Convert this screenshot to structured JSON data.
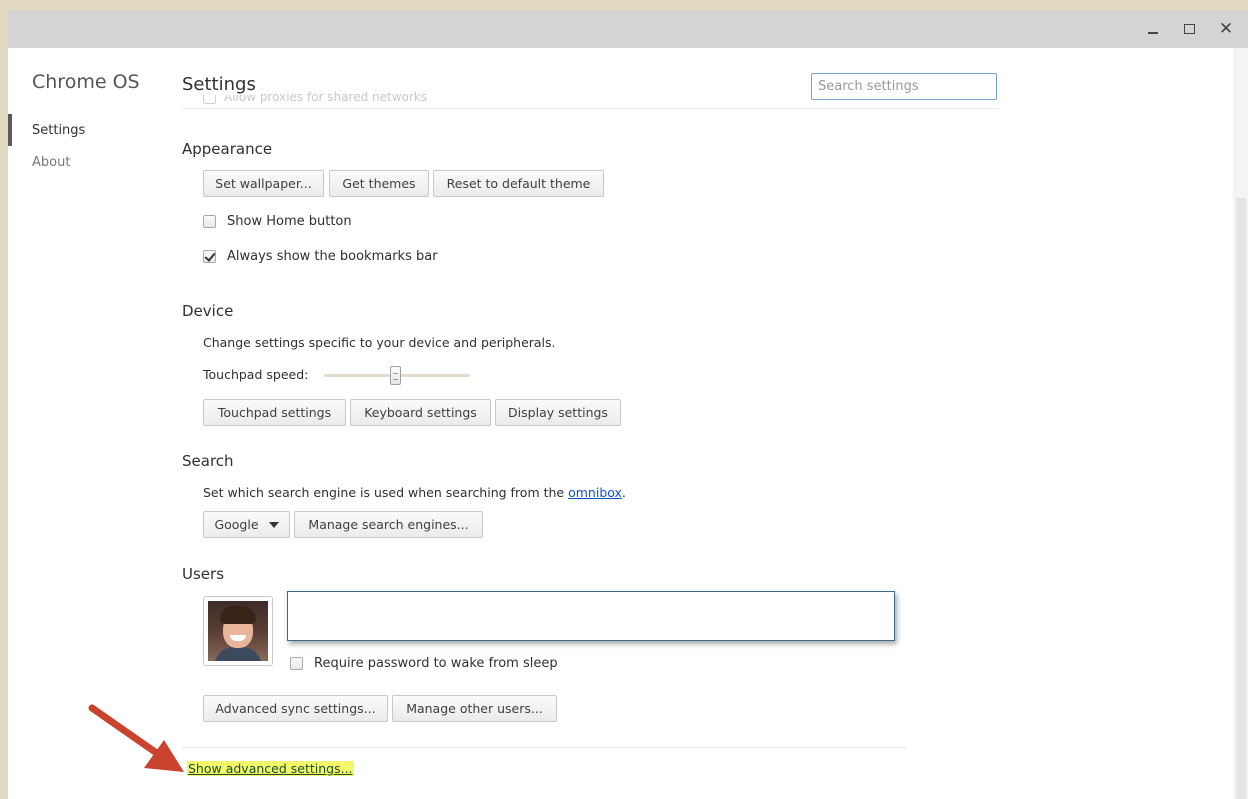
{
  "window_controls": {
    "minimize": "_",
    "maximize": "☐",
    "close": "✕"
  },
  "sidebar": {
    "title": "Chrome OS",
    "items": [
      {
        "label": "Settings",
        "selected": true
      },
      {
        "label": "About",
        "selected": false
      }
    ]
  },
  "header": {
    "title": "Settings",
    "ghost_text": "Allow proxies for shared networks",
    "search_placeholder": "Search settings"
  },
  "appearance": {
    "title": "Appearance",
    "buttons": [
      "Set wallpaper...",
      "Get themes",
      "Reset to default theme"
    ],
    "checks": [
      {
        "label": "Show Home button",
        "checked": false
      },
      {
        "label": "Always show the bookmarks bar",
        "checked": true
      }
    ]
  },
  "device": {
    "title": "Device",
    "description": "Change settings specific to your device and peripherals.",
    "touchpad_label": "Touchpad speed:",
    "touchpad_speed_fraction": 0.5,
    "buttons": [
      "Touchpad settings",
      "Keyboard settings",
      "Display settings"
    ]
  },
  "search": {
    "title": "Search",
    "description_prefix": "Set which search engine is used when searching from the ",
    "description_link": "omnibox",
    "description_suffix": ".",
    "engine_selected": "Google",
    "manage_button": "Manage search engines..."
  },
  "users": {
    "title": "Users",
    "require_password_label": "Require password to wake from sleep",
    "require_password_checked": false,
    "buttons": [
      "Advanced sync settings...",
      "Manage other users..."
    ]
  },
  "footer": {
    "advanced_link": "Show advanced settings..."
  },
  "colors": {
    "annotation_arrow": "#c9432e",
    "highlight": "#f4f76a",
    "link": "#1155cc"
  }
}
